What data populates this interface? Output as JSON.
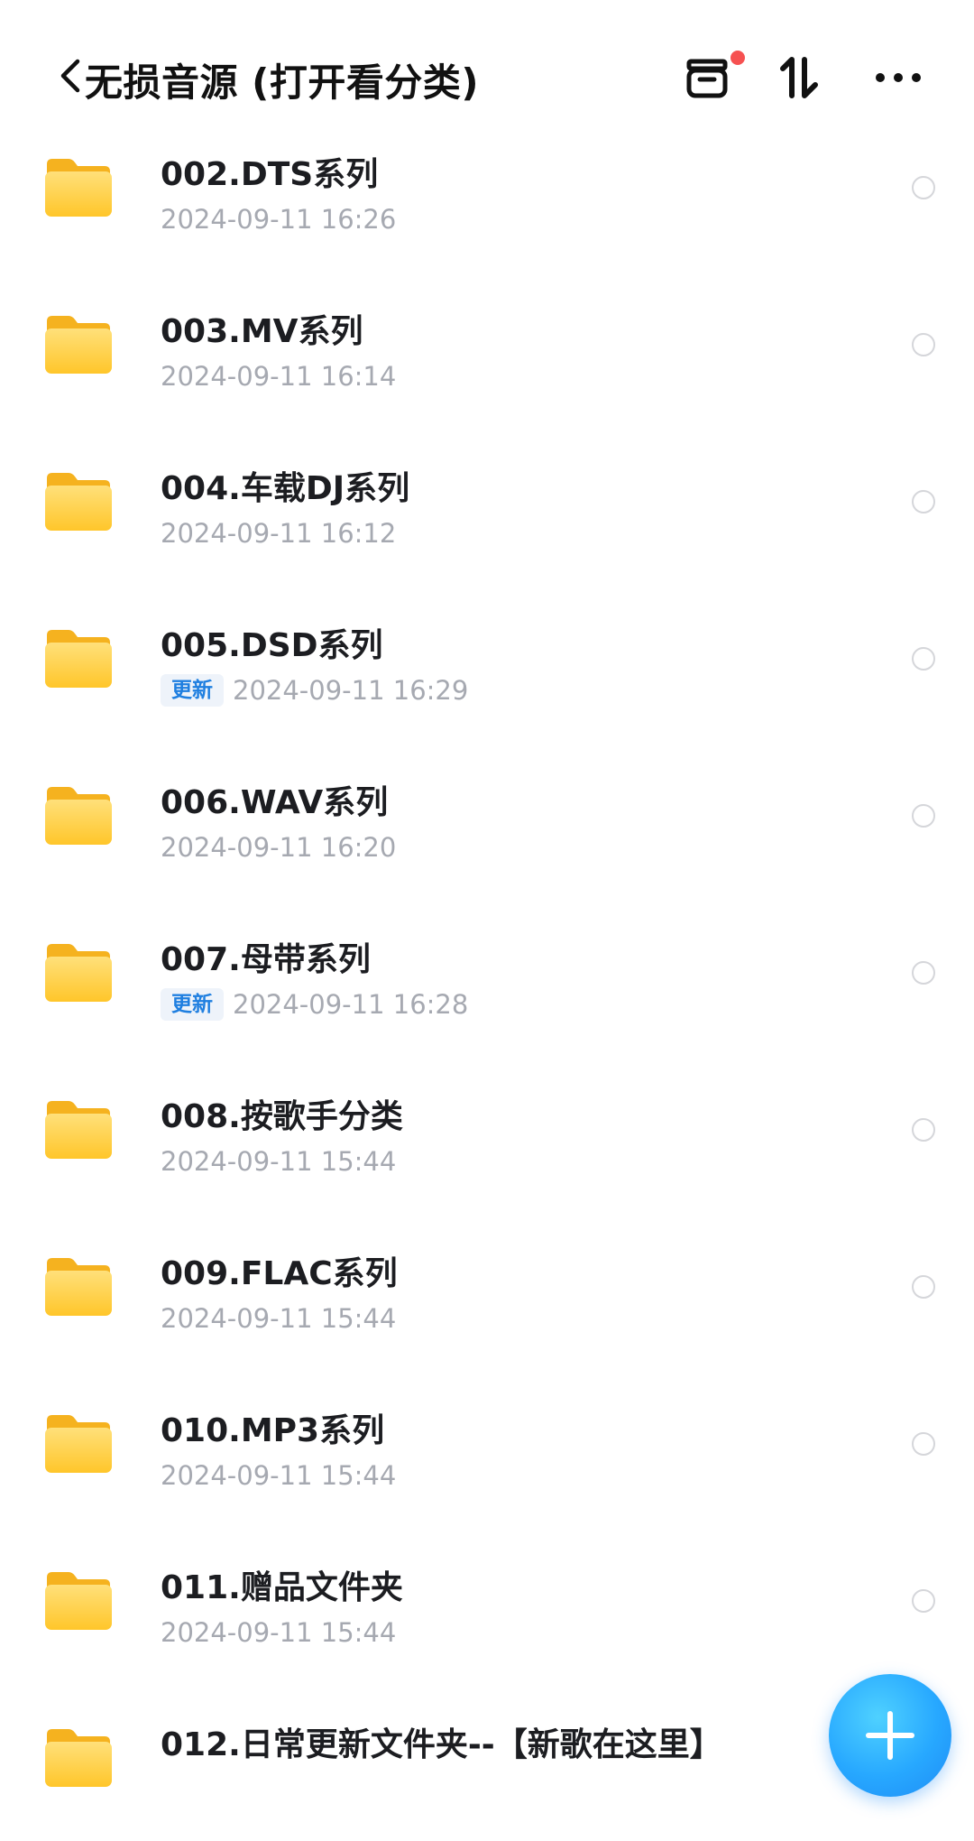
{
  "header": {
    "title": "无损音源 (打开看分类)",
    "icons": [
      "back-icon",
      "inbox-icon",
      "sort-icon",
      "more-icon"
    ],
    "notification_dot_color": "#f65151"
  },
  "folders": [
    {
      "name": "002.DTS系列",
      "date": "2024-09-11 16:26",
      "badge": ""
    },
    {
      "name": "003.MV系列",
      "date": "2024-09-11 16:14",
      "badge": ""
    },
    {
      "name": "004.车载DJ系列",
      "date": "2024-09-11 16:12",
      "badge": ""
    },
    {
      "name": "005.DSD系列",
      "date": "2024-09-11 16:29",
      "badge": "更新"
    },
    {
      "name": "006.WAV系列",
      "date": "2024-09-11 16:20",
      "badge": ""
    },
    {
      "name": "007.母带系列",
      "date": "2024-09-11 16:28",
      "badge": "更新"
    },
    {
      "name": "008.按歌手分类",
      "date": "2024-09-11 15:44",
      "badge": ""
    },
    {
      "name": "009.FLAC系列",
      "date": "2024-09-11 15:44",
      "badge": ""
    },
    {
      "name": "010.MP3系列",
      "date": "2024-09-11 15:44",
      "badge": ""
    },
    {
      "name": "011.赠品文件夹",
      "date": "2024-09-11 15:44",
      "badge": ""
    },
    {
      "name": "012.日常更新文件夹--【新歌在这里】",
      "date": "",
      "badge": ""
    }
  ],
  "fab": {
    "icon": "plus-icon",
    "color": "#27a8ff"
  },
  "colors": {
    "folder": "#ffcf3d",
    "badge_text": "#1f7fe0",
    "date_text": "#a6a9b1"
  }
}
